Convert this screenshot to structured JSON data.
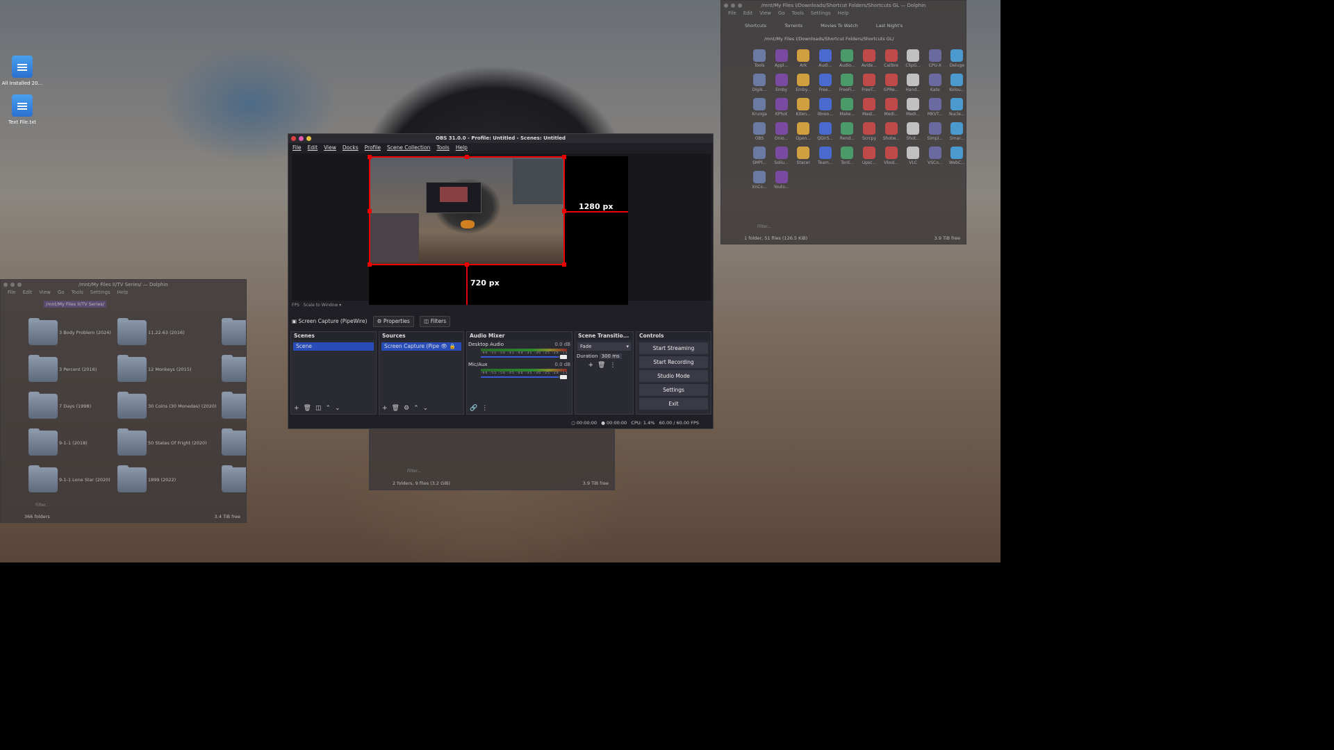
{
  "desktop": {
    "icons": [
      {
        "label": "All Installed 20..."
      },
      {
        "label": "Text File.txt"
      }
    ]
  },
  "dolphin_left": {
    "title": "/mnt/My Files II/TV Series/ — Dolphin",
    "menu": [
      "File",
      "Edit",
      "View",
      "Go",
      "Tools",
      "Settings",
      "Help"
    ],
    "path": "/mnt/My Files II/TV Series/",
    "folders": [
      "3 Body Problem (2024)",
      "11.22.63 (2016)",
      "3 Percent (2016)",
      "12 Monkeys (2015)",
      "7 Days (1998)",
      "30 Coins (30 Monedas) (2020)",
      "9-1-1 (2018)",
      "50 States Of Fright (2020)",
      "9-1-1 Lone Star (2020)",
      "1899 (2022)"
    ],
    "filter": "Filter...",
    "status": "366 folders",
    "free": "3.4 TiB free"
  },
  "dolphin_right": {
    "title": "/mnt/My Files I/Downloads/Shortcut Folders/Shortcuts GL — Dolphin",
    "menu": [
      "File",
      "Edit",
      "View",
      "Go",
      "Tools",
      "Settings",
      "Help"
    ],
    "tabs": [
      "Shortcuts",
      "Torrents",
      "Movies To Watch",
      "Last Night's"
    ],
    "path": "/mnt/My Files I/Downloads/Shortcut Folders/Shortcuts GL/",
    "apps": [
      "Tools",
      "Appl...",
      "Ark",
      "Audi...",
      "Audio...",
      "Avide...",
      "Calibre",
      "ClipG...",
      "CPU-X",
      "Deluge",
      "Digik...",
      "Emby",
      "Emby...",
      "Free...",
      "FreeFi...",
      "FreeT...",
      "GPRe...",
      "Hand...",
      "Kate",
      "Kolou...",
      "Krunga",
      "KPhot",
      "Kiten...",
      "libreo...",
      "Make...",
      "Mast...",
      "Medi...",
      "Medi...",
      "MKVT...",
      "Nucle...",
      "OBS",
      "Onio...",
      "Open...",
      "QDirS...",
      "Rend...",
      "Scrcpy",
      "Shotw...",
      "Shot...",
      "Simpl...",
      "Smar...",
      "SMPl...",
      "Soliu...",
      "Stacer",
      "Team...",
      "Tord...",
      "Upsc...",
      "Vkod...",
      "VLC",
      "VSCo...",
      "WebC...",
      "XnCo...",
      "Youto..."
    ],
    "filter": "Filter...",
    "status": "1 folder, 51 files (126.5 KiB)",
    "free": "3.9 TiB free"
  },
  "dolphin_mid": {
    "filter": "Filter...",
    "status": "2 folders, 9 files (3.2 GiB)",
    "free": "3.9 TiB free"
  },
  "obs": {
    "title": "OBS 31.0.0 - Profile: Untitled - Scenes: Untitled",
    "menu": [
      "File",
      "Edit",
      "View",
      "Docks",
      "Profile",
      "Scene Collection",
      "Tools",
      "Help"
    ],
    "width_label": "1280 px",
    "height_label": "720 px",
    "scale": "Scale to Window",
    "fps_small": "FPS",
    "source_bar": {
      "name": "Screen Capture (PipeWire)",
      "properties": "Properties",
      "filters": "Filters"
    },
    "scenes": {
      "title": "Scenes",
      "items": [
        "Scene"
      ]
    },
    "sources": {
      "title": "Sources",
      "items": [
        "Screen Capture (Pipe"
      ]
    },
    "mixer": {
      "title": "Audio Mixer",
      "channels": [
        {
          "name": "Desktop Audio",
          "db": "0.0 dB",
          "level": 0.9
        },
        {
          "name": "Mic/Aux",
          "db": "0.0 dB",
          "level": 0.9
        }
      ],
      "ticks": "-60 -55 -50 -45 -40 -35 -30 -25 -20 -15 -10 -5 0"
    },
    "transitions": {
      "title": "Scene Transitio...",
      "selected": "Fade",
      "duration_label": "Duration",
      "duration": "300 ms"
    },
    "controls": {
      "title": "Controls",
      "buttons": [
        "Start Streaming",
        "Start Recording",
        "Studio Mode",
        "Settings",
        "Exit"
      ]
    },
    "status": {
      "stream_time": "00:00:00",
      "rec_time": "00:00:00",
      "cpu": "CPU: 1.4%",
      "fps": "60.00 / 60.00 FPS"
    }
  }
}
